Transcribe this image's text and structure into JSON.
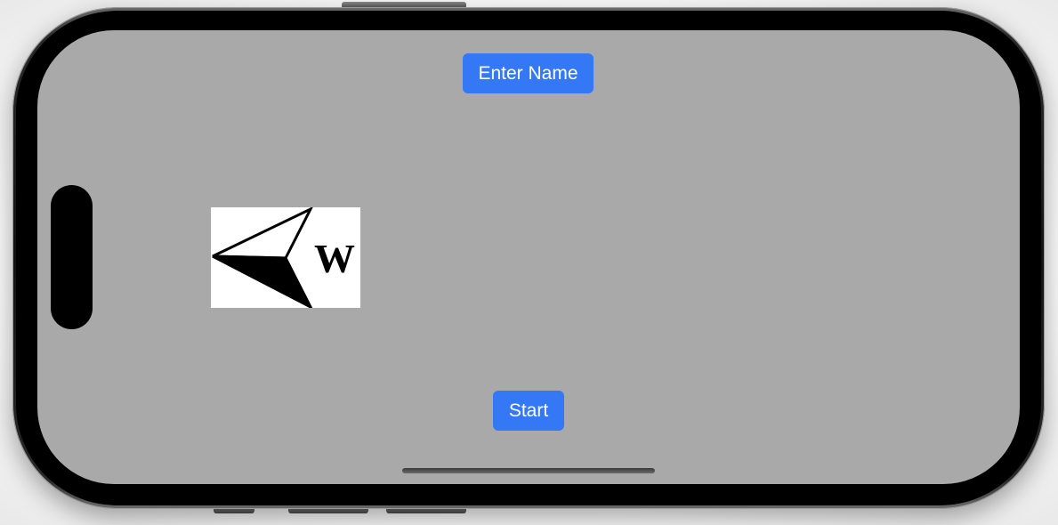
{
  "device": {
    "screen_color": "#a9a9a9",
    "frame_color": "#000000"
  },
  "buttons": {
    "enter_name_label": "Enter Name",
    "start_label": "Start",
    "accent_color": "#3478f6"
  },
  "compass": {
    "icon": "compass-arrow-west-icon",
    "heading_letter": "W"
  }
}
